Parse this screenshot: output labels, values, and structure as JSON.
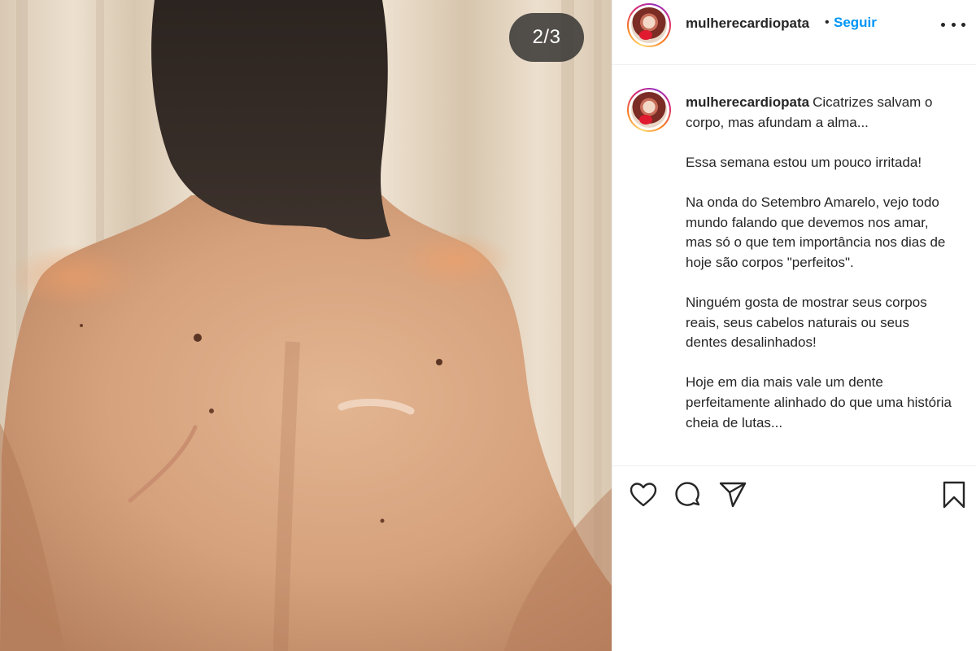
{
  "post": {
    "slide_counter": "2/3",
    "image_alt": "Foto de costas com cicatrizes"
  },
  "header": {
    "username": "mulherecardiopata",
    "separator": "•",
    "follow_label": "Seguir",
    "more_icon": "more-horizontal-icon"
  },
  "caption": {
    "username": "mulherecardiopata",
    "paragraphs": [
      "Cicatrizes salvam o corpo, mas afundam a alma...",
      "Essa semana estou um pouco irritada!",
      "Na onda do Setembro Amarelo, vejo todo mundo falando que devemos nos amar, mas só o que tem importância nos dias de hoje são corpos \"perfeitos\".",
      "Ninguém gosta de mostrar seus corpos reais, seus cabelos naturais ou seus dentes desalinhados!",
      "Hoje em dia mais vale um dente perfeitamente alinhado do que uma história cheia de lutas..."
    ]
  },
  "actions": {
    "like_icon": "heart-icon",
    "comment_icon": "comment-icon",
    "share_icon": "paper-plane-icon",
    "save_icon": "bookmark-icon"
  },
  "colors": {
    "link_blue": "#0095f6",
    "text": "#262626",
    "divider": "#efefef"
  }
}
